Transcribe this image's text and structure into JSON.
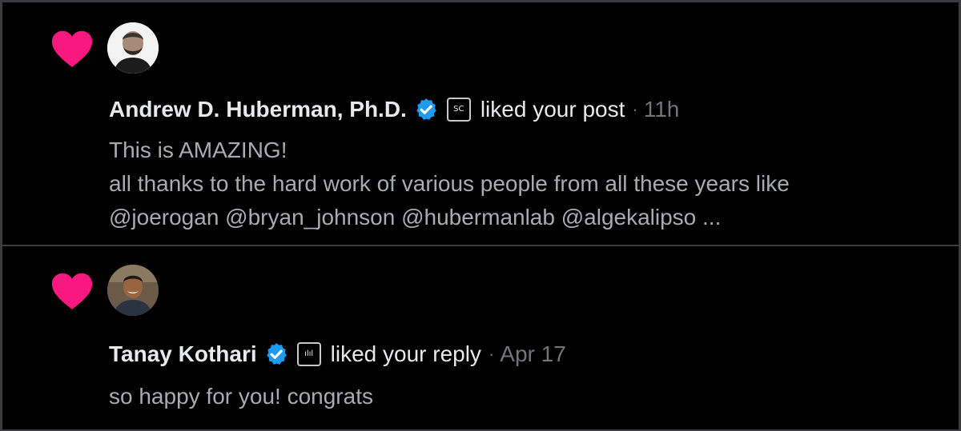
{
  "colors": {
    "background": "#000000",
    "heart": "#f91880",
    "verified": "#1d9bf0",
    "primary_text": "#e7e9ea",
    "secondary_text": "#71767b",
    "border": "#3a3b3d"
  },
  "notifications": [
    {
      "type_icon": "heart-icon",
      "user_name": "Andrew D. Huberman, Ph.D.",
      "verified_icon": "verified-badge-icon",
      "affiliate_badge": "SC",
      "action": "liked your post",
      "separator": "·",
      "time": "11h",
      "text_lines": [
        "This is AMAZING!",
        "all thanks to the hard work of various people from all these years like",
        "@joerogan @bryan_johnson @hubermanlab @algekalipso ..."
      ]
    },
    {
      "type_icon": "heart-icon",
      "user_name": "Tanay Kothari",
      "verified_icon": "verified-badge-icon",
      "affiliate_badge": "ılıl",
      "action": "liked your reply",
      "separator": "·",
      "time": "Apr 17",
      "text_lines": [
        "so happy for you! congrats"
      ]
    }
  ]
}
